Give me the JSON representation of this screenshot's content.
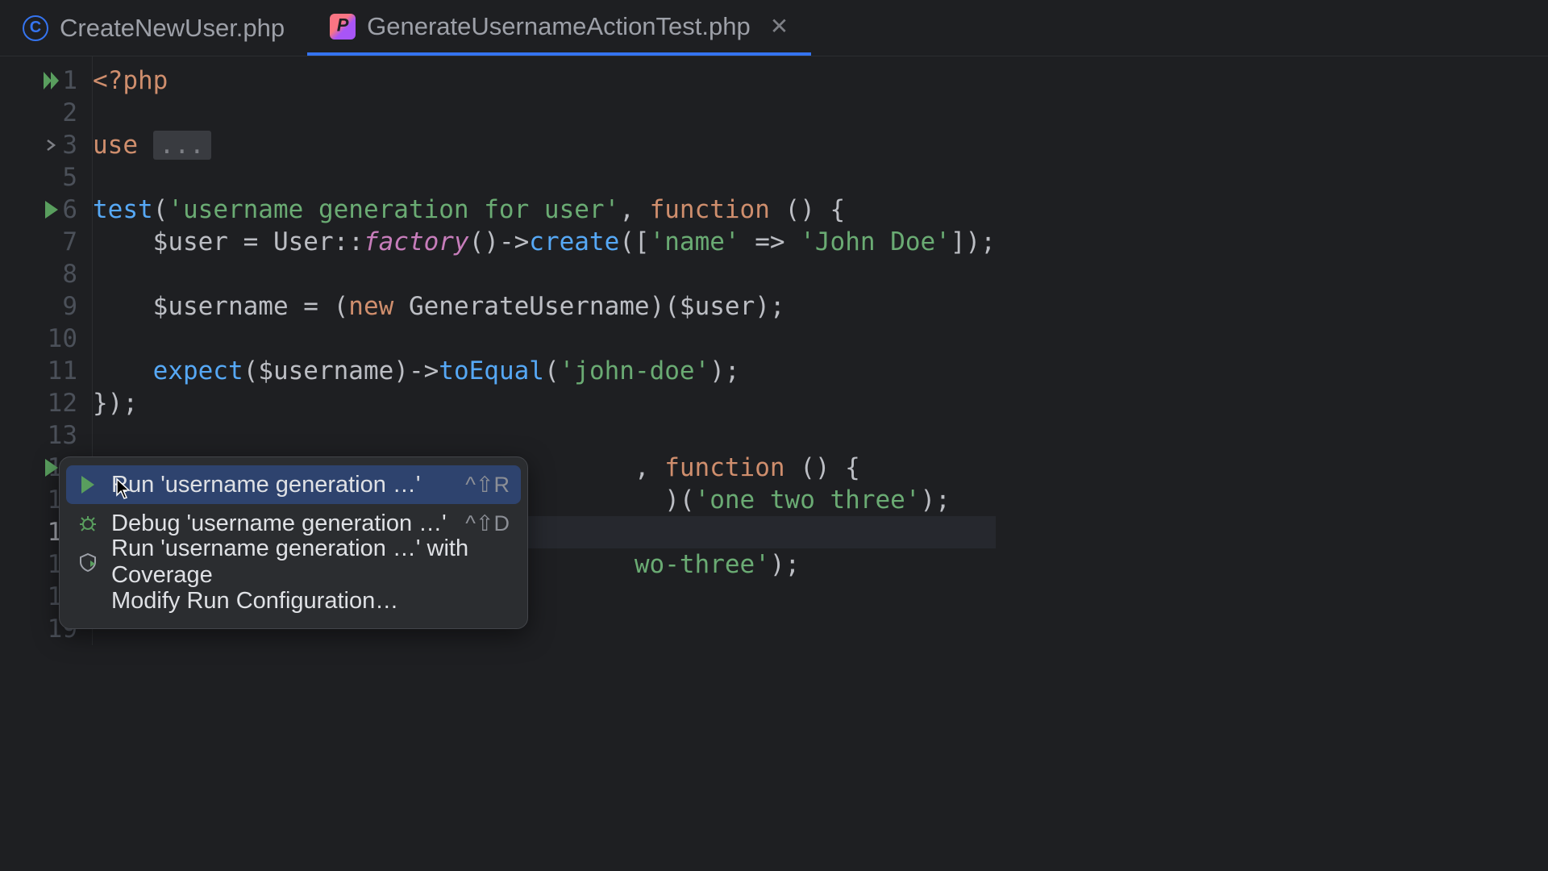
{
  "tabs": [
    {
      "filename": "CreateNewUser.php",
      "icon": "copyright"
    },
    {
      "filename": "GenerateUsernameActionTest.php",
      "icon": "pest",
      "active": true,
      "closable": true
    }
  ],
  "gutter": {
    "line_count": 19,
    "current_line": 16,
    "icons": {
      "1": "double-run",
      "3": "fold",
      "6": "run",
      "14": "run"
    }
  },
  "code": {
    "l1": "<?php",
    "l3_use": "use",
    "l3_fold": "...",
    "l6_test": "test",
    "l6_str": "'username generation for user'",
    "l6_func": "function",
    "l7_var": "$user",
    "l7_class": "User",
    "l7_factory": "factory",
    "l7_create": "create",
    "l7_key": "'name'",
    "l7_val": "'John Doe'",
    "l9_var": "$username",
    "l9_new": "new",
    "l9_class": "GenerateUsername",
    "l9_arg": "$user",
    "l11_expect": "expect",
    "l11_var": "$username",
    "l11_toequal": "toEqual",
    "l11_str": "'john-doe'",
    "l12_end": "});",
    "l14_func": "function",
    "l15_str": "'one two three'",
    "l17_str": "wo-three'"
  },
  "context_menu": {
    "items": [
      {
        "label": "Run 'username generation …'",
        "shortcut": "^⇧R",
        "icon": "play",
        "selected": true
      },
      {
        "label": "Debug 'username generation …'",
        "shortcut": "^⇧D",
        "icon": "bug"
      },
      {
        "label": "Run 'username generation …' with Coverage",
        "icon": "coverage"
      },
      {
        "label": "Modify Run Configuration…",
        "icon": "none"
      }
    ]
  }
}
